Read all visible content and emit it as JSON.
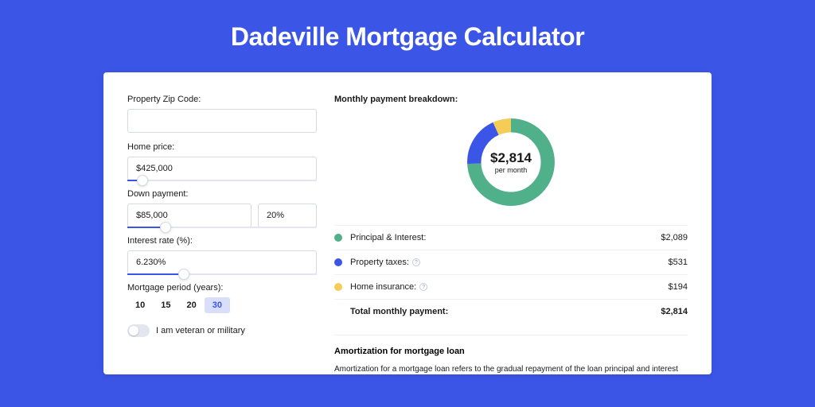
{
  "title": "Dadeville Mortgage Calculator",
  "form": {
    "zip": {
      "label": "Property Zip Code:",
      "value": ""
    },
    "home_price": {
      "label": "Home price:",
      "value": "$425,000",
      "slider_pct": 8
    },
    "down_payment": {
      "label": "Down payment:",
      "amount": "$85,000",
      "percent": "20%",
      "slider_pct": 20
    },
    "interest_rate": {
      "label": "Interest rate (%):",
      "value": "6.230%",
      "slider_pct": 30
    },
    "mortgage_period": {
      "label": "Mortgage period (years):",
      "options": [
        "10",
        "15",
        "20",
        "30"
      ],
      "active": "30"
    },
    "veteran": {
      "label": "I am veteran or military",
      "checked": false
    }
  },
  "breakdown": {
    "title": "Monthly payment breakdown:",
    "center_amount": "$2,814",
    "center_sub": "per month",
    "items": [
      {
        "label": "Principal & Interest:",
        "value": "$2,089",
        "color": "#4fb08a",
        "info": false,
        "num": 2089
      },
      {
        "label": "Property taxes:",
        "value": "$531",
        "color": "#3b55e6",
        "info": true,
        "num": 531
      },
      {
        "label": "Home insurance:",
        "value": "$194",
        "color": "#f4cc56",
        "info": true,
        "num": 194
      }
    ],
    "total_label": "Total monthly payment:",
    "total_value": "$2,814"
  },
  "amortization": {
    "title": "Amortization for mortgage loan",
    "text": "Amortization for a mortgage loan refers to the gradual repayment of the loan principal and interest over a specified"
  },
  "chart_data": {
    "type": "pie",
    "title": "Monthly payment breakdown",
    "series": [
      {
        "name": "Principal & Interest",
        "value": 2089,
        "color": "#4fb08a"
      },
      {
        "name": "Property taxes",
        "value": 531,
        "color": "#3b55e6"
      },
      {
        "name": "Home insurance",
        "value": 194,
        "color": "#f4cc56"
      }
    ],
    "total": 2814,
    "center_label": "$2,814 per month"
  }
}
